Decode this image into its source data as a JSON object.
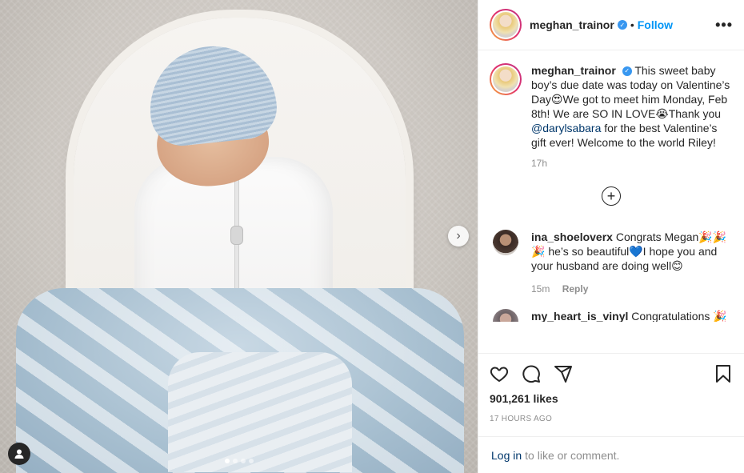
{
  "post": {
    "username": "meghan_trainor",
    "follow_label": "Follow",
    "bullet": "•",
    "more_label": "•••",
    "verified_glyph": "✓"
  },
  "caption": {
    "username": "meghan_trainor",
    "text_before_mention": "This sweet baby boy’s due date was today on Valentine’s Day😍We got to meet him Monday, Feb 8th! We are SO IN LOVE😭Thank you ",
    "mention": "@darylsabara",
    "text_after_mention": " for the best Valentine’s gift ever! Welcome to the world Riley!",
    "time": "17h"
  },
  "load_more": {
    "glyph": "+",
    "icon": "plus-circle-icon"
  },
  "comments": [
    {
      "username": "ina_shoeloverx",
      "text": "Congrats Megan🎉🎉🎉 he’s so beautiful💙I hope you and your husband are doing well😊",
      "time": "15m",
      "reply_label": "Reply"
    },
    {
      "username": "my_heart_is_vinyl",
      "text": "Congratulations 🎉"
    }
  ],
  "actions": {
    "like_icon": "heart-icon",
    "comment_icon": "comment-icon",
    "share_icon": "share-icon",
    "save_icon": "bookmark-icon"
  },
  "likes_text": "901,261 likes",
  "posted_ago": "17 HOURS AGO",
  "login": {
    "link_text": "Log in",
    "rest_text": "to like or comment."
  },
  "media": {
    "next_glyph": "›",
    "carousel_count": 4,
    "carousel_active": 1,
    "tag_icon": "user-tag-icon"
  },
  "colors": {
    "link_blue": "#0095f6",
    "mention_blue": "#00376b",
    "muted": "#8e8e8e",
    "text": "#262626"
  }
}
